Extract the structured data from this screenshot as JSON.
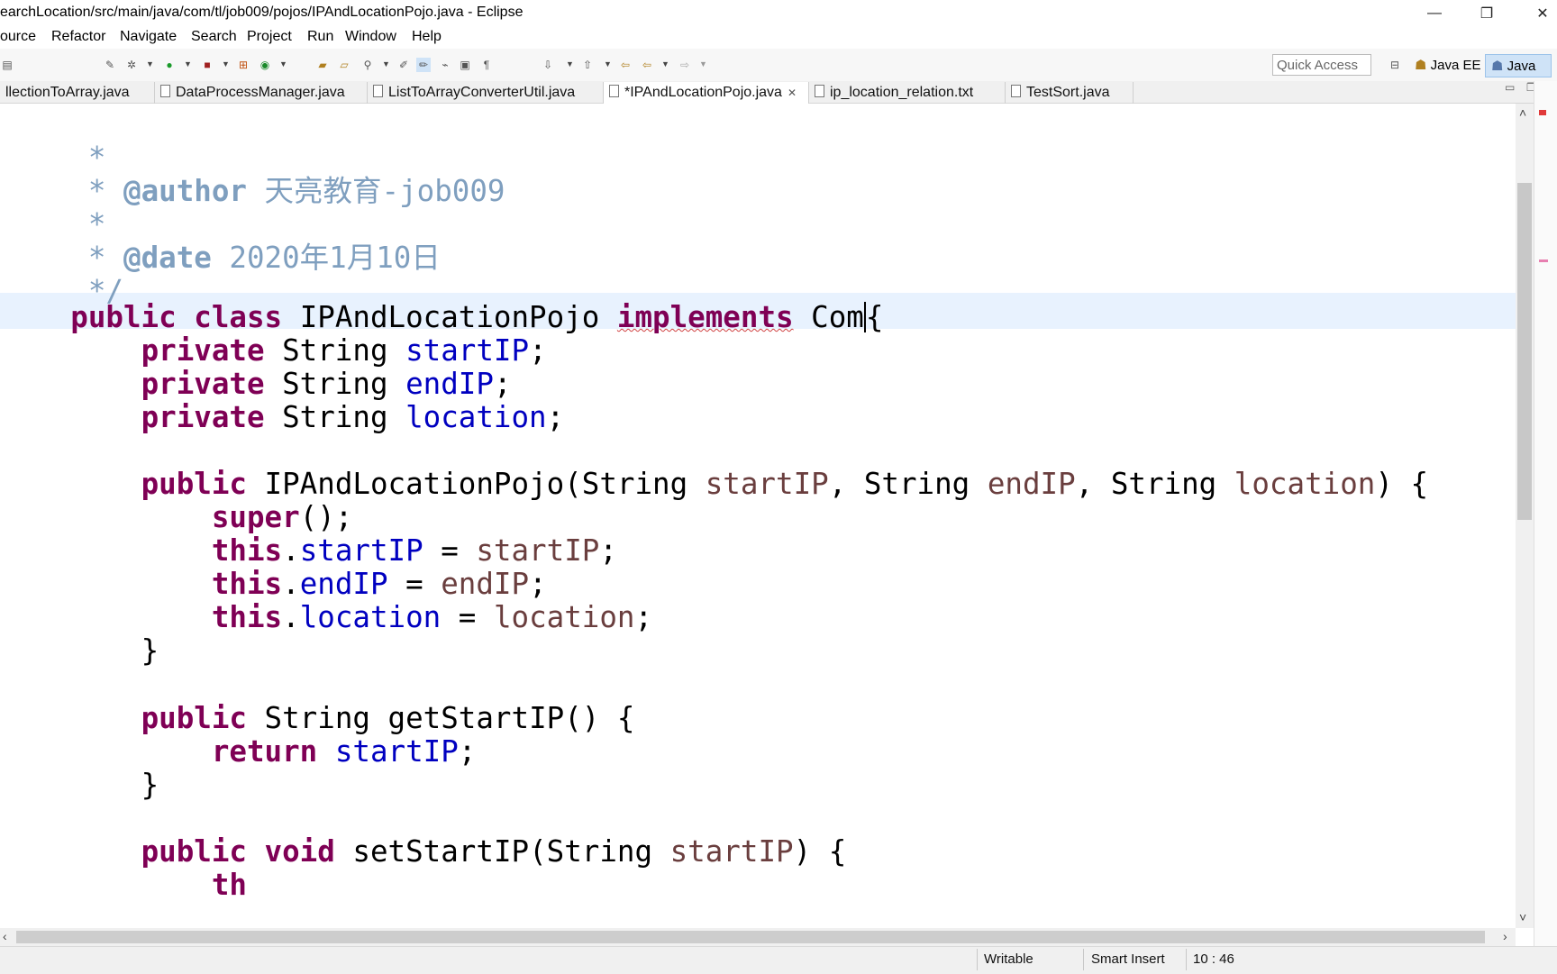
{
  "window": {
    "title": "earchLocation/src/main/java/com/tl/job009/pojos/IPAndLocationPojo.java - Eclipse",
    "minimize_glyph": "—",
    "restore_glyph": "❐",
    "close_glyph": "✕"
  },
  "menu": [
    "ource",
    "Refactor",
    "Navigate",
    "Search",
    "Project",
    "Run",
    "Window",
    "Help"
  ],
  "toolbar": {
    "quick_access_placeholder": "Quick Access",
    "perspectives": [
      "Java EE",
      "Java"
    ]
  },
  "tabs": [
    {
      "label": "llectionToArray.java",
      "active": false
    },
    {
      "label": "DataProcessManager.java",
      "active": false
    },
    {
      "label": "ListToArrayConverterUtil.java",
      "active": false
    },
    {
      "label": "*IPAndLocationPojo.java",
      "active": true,
      "close": "✕"
    },
    {
      "label": "ip_location_relation.txt",
      "active": false
    },
    {
      "label": "TestSort.java",
      "active": false
    }
  ],
  "code": {
    "l1_star": "*",
    "l2_star": "* ",
    "l2_tag": "@author",
    "l2_text": " 天亮教育-job009",
    "l3_star": "*",
    "l4_star": "* ",
    "l4_tag": "@date",
    "l4_text": " 2020年1月10日",
    "l5_end": "*/",
    "l6_kw1": "public",
    "l6_kw2": "class",
    "l6_name": "IPAndLocationPojo",
    "l6_kw3": "implements",
    "l6_iface": "Com",
    "l6_brace": "{",
    "kw_private": "private",
    "type_string": "String",
    "f_start": "startIP",
    "f_end": "endIP",
    "f_loc": "location",
    "semi": ";",
    "kw_public": "public",
    "ctor_name": "IPAndLocationPojo(",
    "comma": ", ",
    "ctor_end": ") {",
    "kw_super": "super",
    "super_call": "();",
    "kw_this": "this",
    "dot": ".",
    "assign": " = ",
    "rbrace": "}",
    "getter_sig": "getStartIP() {",
    "kw_return": "return",
    "kw_void": "void",
    "setter_sig": "setStartIP(String ",
    "setter_end": ") {",
    "line_cut": "th"
  },
  "status": {
    "writable": "Writable",
    "insert_mode": "Smart Insert",
    "position": "10 : 46"
  }
}
